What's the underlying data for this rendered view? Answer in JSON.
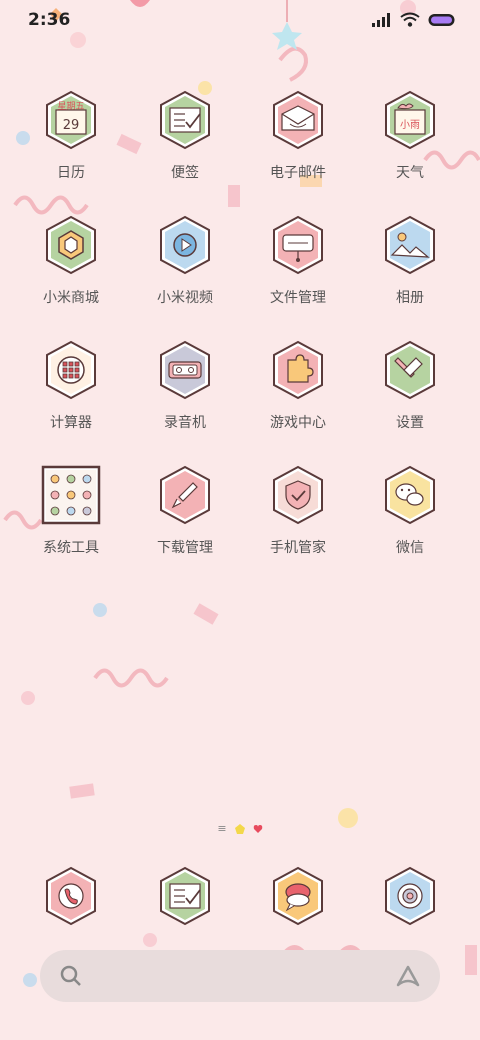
{
  "status": {
    "time": "2:36"
  },
  "apps": [
    {
      "label": "日历",
      "icon": "calendar-icon",
      "weekday": "星期五",
      "date": "29"
    },
    {
      "label": "便签",
      "icon": "notes-icon"
    },
    {
      "label": "电子邮件",
      "icon": "email-icon"
    },
    {
      "label": "天气",
      "icon": "weather-icon",
      "weather_text": "小雨"
    },
    {
      "label": "小米商城",
      "icon": "mi-store-icon"
    },
    {
      "label": "小米视频",
      "icon": "video-icon"
    },
    {
      "label": "文件管理",
      "icon": "file-manager-icon"
    },
    {
      "label": "相册",
      "icon": "gallery-icon"
    },
    {
      "label": "计算器",
      "icon": "calculator-icon"
    },
    {
      "label": "录音机",
      "icon": "recorder-icon"
    },
    {
      "label": "游戏中心",
      "icon": "game-center-icon"
    },
    {
      "label": "设置",
      "icon": "settings-icon"
    },
    {
      "label": "系统工具",
      "icon": "system-tools-folder-icon"
    },
    {
      "label": "下载管理",
      "icon": "download-icon"
    },
    {
      "label": "手机管家",
      "icon": "security-icon"
    },
    {
      "label": "微信",
      "icon": "wechat-icon"
    }
  ],
  "dock": [
    {
      "icon": "phone-icon"
    },
    {
      "icon": "notes-icon"
    },
    {
      "icon": "messages-icon"
    },
    {
      "icon": "camera-icon"
    }
  ],
  "colors": {
    "background": "#fbe9e9",
    "icon_outline": "#5a3a3a",
    "label_text": "#555555"
  }
}
